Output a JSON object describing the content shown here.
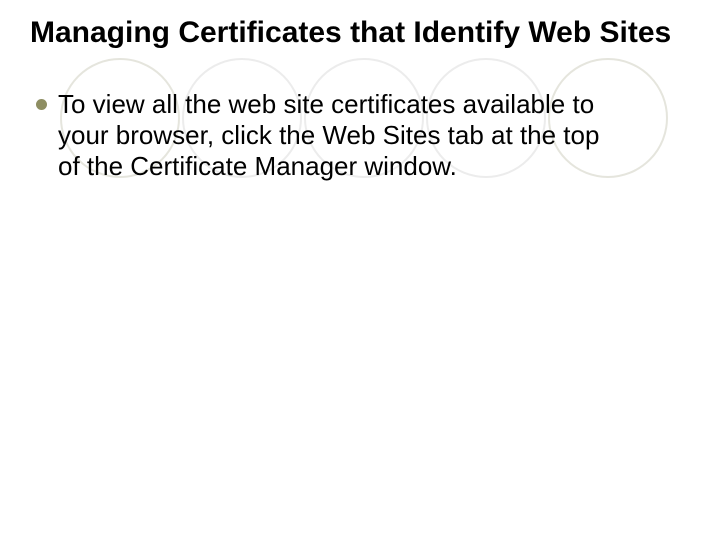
{
  "slide": {
    "title": "Managing Certificates that Identify Web Sites",
    "bullets": [
      "To view all the web site certificates available to your browser, click the Web Sites tab at the top of the Certificate Manager window."
    ]
  }
}
